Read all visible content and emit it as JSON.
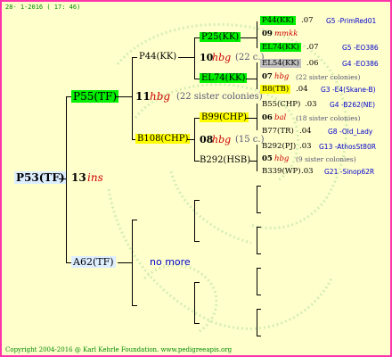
{
  "header": {
    "date": "28- 1-2016 ( 17: 46)"
  },
  "footer": {
    "copyright": "Copyright 2004-2016 @ Karl Kehrle Foundation.   www.pedigreeapis.org"
  },
  "colors": {
    "border": "#ff33aa",
    "background": "#ffffcc",
    "green_tag": "#00ee00",
    "yellow_tag": "#ffff00",
    "grey_tag": "#c0c0c0",
    "link_blue": "#0000cc",
    "red_text": "#cc0000"
  },
  "root": {
    "id": "P53(TF)",
    "gen": "13",
    "note": "ins"
  },
  "gen1": {
    "upper": {
      "id": "P55(TF)",
      "gen": "11",
      "note": "hbg",
      "siblings": "(22 sister colonies)"
    },
    "lower": {
      "id": "A62(TF)",
      "no_more": "no more"
    }
  },
  "gen2": {
    "p44": {
      "id": "P44(KK)"
    },
    "b108": {
      "id": "B108(CHP)"
    }
  },
  "gen3": {
    "p25": {
      "id": "P25(KK)",
      "gen": "10",
      "note": "hbg",
      "siblings": "(22 c.)"
    },
    "el74": {
      "id": "EL74(KK)"
    },
    "b99": {
      "id": "B99(CHP)",
      "gen": "08",
      "note": "hbg",
      "siblings": "(15 c.)"
    },
    "b292": {
      "id": "B292(HSB)"
    }
  },
  "gen4": [
    {
      "id": "P44(KK)",
      "year": ".07",
      "source": "G5 -PrimRed01"
    },
    {
      "gen": "09",
      "note": "mmkk"
    },
    {
      "id": "EL74(KK)",
      "year": ".07",
      "source": "G5 -EO386"
    },
    {
      "id": "EL54(KK)",
      "year": ".06",
      "source": "G4 -EO386"
    },
    {
      "gen": "07",
      "note": "hbg",
      "siblings": "(22 sister colonies)"
    },
    {
      "id": "B8(TB)",
      "year": ".04",
      "source": "G3 -E4(Skane-B)"
    },
    {
      "id": "B55(CHP)",
      "year": ".03",
      "source": "G4 -B262(NE)"
    },
    {
      "gen": "06",
      "note": "bal",
      "siblings": "(18 sister colonies)"
    },
    {
      "id": "B77(TR)",
      "year": ".04",
      "source": "G8 -Old_Lady"
    },
    {
      "id": "B292(PJ)",
      "year": ".03",
      "source": "G13 -AthosSt80R"
    },
    {
      "gen": "05",
      "note": "hbg",
      "siblings": "(9 sister colonies)"
    },
    {
      "id": "B339(WP)",
      "year": ".03",
      "source": "G21 -Sinop62R"
    }
  ]
}
